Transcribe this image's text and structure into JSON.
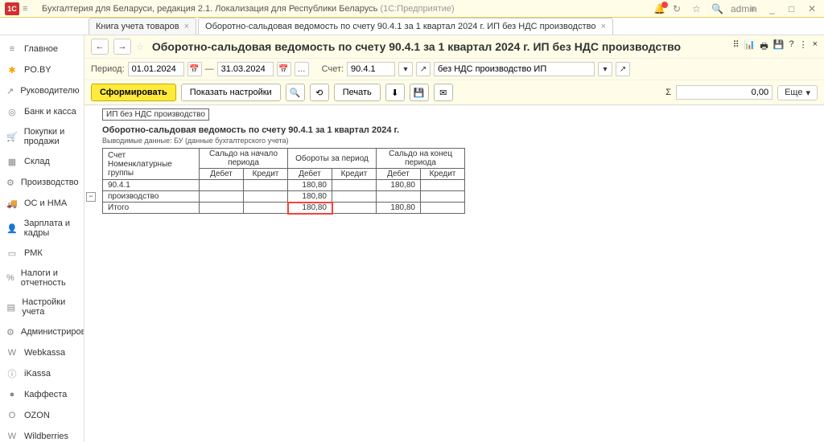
{
  "topbar": {
    "app_title": "Бухгалтерия для Беларуси, редакция 2.1. Локализация для Республики Беларусь",
    "app_sub": "(1С:Предприятие)",
    "user": "admin"
  },
  "tabs": [
    {
      "label": "Книга учета товаров",
      "active": false
    },
    {
      "label": "Оборотно-сальдовая ведомость по счету 90.4.1 за 1 квартал 2024 г. ИП без НДС производство",
      "active": true
    }
  ],
  "sidebar": [
    {
      "label": "Главное",
      "icon": "≡"
    },
    {
      "label": "PO.BY",
      "icon": "✱",
      "star": true
    },
    {
      "label": "Руководителю",
      "icon": "↗"
    },
    {
      "label": "Банк и касса",
      "icon": "◎"
    },
    {
      "label": "Покупки и продажи",
      "icon": "🛒"
    },
    {
      "label": "Склад",
      "icon": "▦"
    },
    {
      "label": "Производство",
      "icon": "⚙"
    },
    {
      "label": "ОС и НМА",
      "icon": "🚚"
    },
    {
      "label": "Зарплата и кадры",
      "icon": "👤"
    },
    {
      "label": "РМК",
      "icon": "▭"
    },
    {
      "label": "Налоги и отчетность",
      "icon": "%"
    },
    {
      "label": "Настройки учета",
      "icon": "▤"
    },
    {
      "label": "Администрирование",
      "icon": "⚙"
    },
    {
      "label": "Webkassa",
      "icon": "W"
    },
    {
      "label": "iKassa",
      "icon": "ⓘ"
    },
    {
      "label": "Каффеста",
      "icon": "●"
    },
    {
      "label": "OZON",
      "icon": "O"
    },
    {
      "label": "Wildberries",
      "icon": "W"
    }
  ],
  "document": {
    "title": "Оборотно-сальдовая ведомость по счету 90.4.1 за 1 квартал 2024 г. ИП без НДС производство",
    "period_label": "Период:",
    "date_from": "01.01.2024",
    "date_to": "31.03.2024",
    "account_label": "Счет:",
    "account": "90.4.1",
    "org": "без НДС производство ИП",
    "dash": "—"
  },
  "toolbar": {
    "form": "Сформировать",
    "show_settings": "Показать настройки",
    "print": "Печать",
    "sum_value": "0,00",
    "more": "Еще"
  },
  "report": {
    "org_line": "ИП без НДС производство",
    "title": "Оборотно-сальдовая ведомость по счету 90.4.1 за 1 квартал 2024 г.",
    "sub": "Выводимые данные: БУ (данные бухгалтерского учета)",
    "headers": {
      "acct": "Счет",
      "nom": "Номенклатурные группы",
      "saldo_start": "Сальдо на начало периода",
      "turnover": "Обороты за период",
      "saldo_end": "Сальдо на конец периода",
      "debit": "Дебет",
      "credit": "Кредит"
    },
    "rows": [
      {
        "label": "90.4.1",
        "t_debit": "180,80",
        "e_debit": "180,80"
      },
      {
        "label": "производство",
        "t_debit": "180,80"
      },
      {
        "label": "Итого",
        "t_debit": "180,80",
        "e_debit": "180,80",
        "hl": true
      }
    ]
  }
}
